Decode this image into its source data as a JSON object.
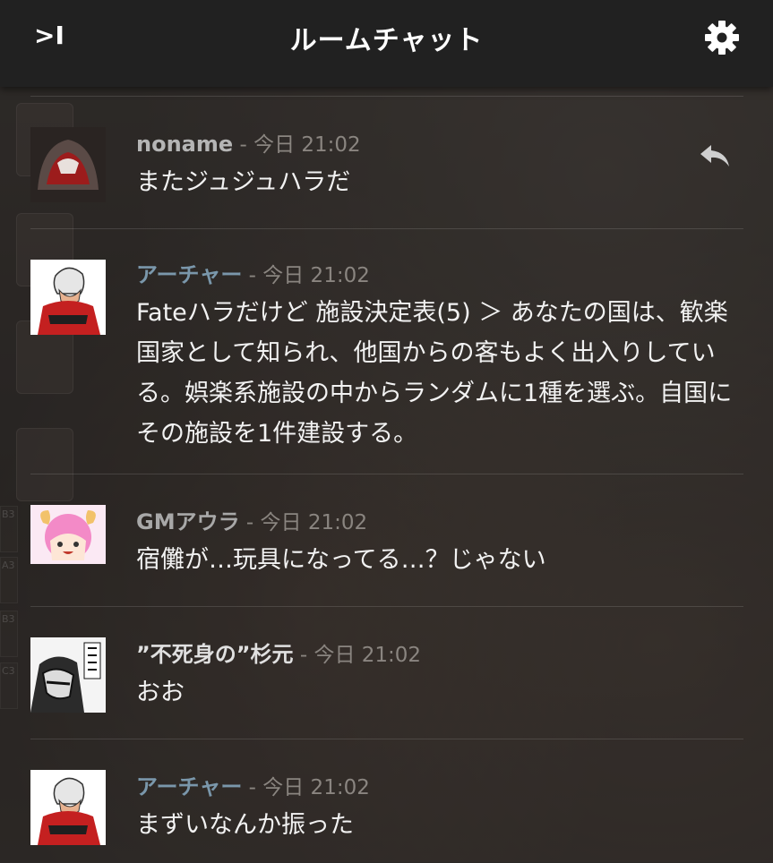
{
  "header": {
    "title": "ルームチャット",
    "collapse_label": ">I",
    "settings_icon": "gear-icon"
  },
  "sidebar": {
    "cells": [
      "B3",
      "A3",
      "B3",
      "C3"
    ]
  },
  "messages": [
    {
      "name": "noname",
      "sep": " - ",
      "time": "今日 21:02",
      "text": "またジュジュハラだ",
      "name_color": "#b5b5b5",
      "avatar": "red-hood-avatar"
    },
    {
      "name": "アーチャー",
      "sep": " - ",
      "time": "今日 21:02",
      "text": "Fateハラだけど 施設決定表(5) ＞ あなたの国は、歓楽国家として知られ、他国からの客もよく出入りしている。娯楽系施設の中からランダムに1種を選ぶ。自国にその施設を1件建設する。",
      "name_color": "#7a97ab",
      "avatar": "archer-avatar"
    },
    {
      "name": "GMアウラ",
      "sep": " - ",
      "time": "今日 21:02",
      "text": "宿儺が…玩具になってる…？じゃない",
      "name_color": "#a8a8a8",
      "avatar": "aura-avatar"
    },
    {
      "name": "”不死身の”杉元",
      "sep": " - ",
      "time": "今日 21:02",
      "text": "おお",
      "name_color": "#e0e0e0",
      "avatar": "sugimoto-avatar"
    },
    {
      "name": "アーチャー",
      "sep": " - ",
      "time": "今日 21:02",
      "text": "まずいなんか振った",
      "name_color": "#7a97ab",
      "avatar": "archer-avatar"
    }
  ]
}
